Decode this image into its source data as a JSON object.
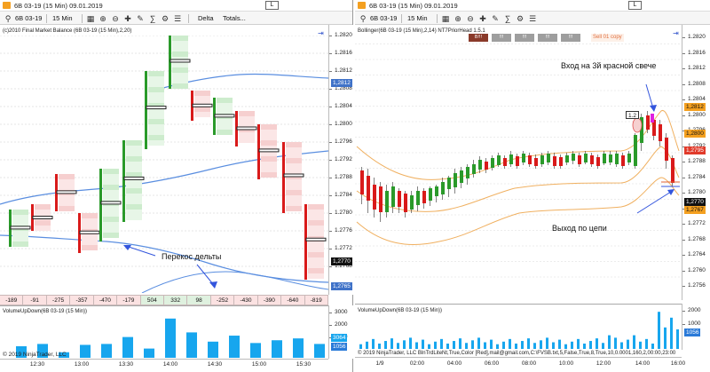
{
  "left_window": {
    "title": "6B 03-19 (15 Min)  09.01.2019",
    "maximize_label": "L",
    "toolbar": {
      "instrument": "6B 03-19",
      "timeframe": "15 Min",
      "style": "Delta",
      "totals": "Totals..."
    },
    "chart_label": "(c)2010 Final Market Balance  (6B 03-19 (15 Min),2,20)",
    "price_labels": [
      "1.2820",
      "1.2816",
      "1.2812",
      "1.2808",
      "1.2804",
      "1.2800",
      "1.2796",
      "1.2792",
      "1.2788",
      "1.2784",
      "1.2780",
      "1.2776",
      "1.2772",
      "1.2768"
    ],
    "tags": {
      "upper_band": "1,2812",
      "last_price": "1,2770",
      "lower_band": "1,2765"
    },
    "delta_row": [
      "-189",
      "-91",
      "-275",
      "-357",
      "-470",
      "-179",
      "504",
      "332",
      "98",
      "-252",
      "-430",
      "-390",
      "-640",
      "-819"
    ],
    "annotation": "Перекос дельты",
    "volume_label": "VolumeUpDown(6B 03-19 (15 Min))",
    "volume_axis": [
      "3000",
      "2000",
      "1000"
    ],
    "volume_tags": [
      "3064",
      "1056"
    ],
    "copyright": "© 2019 NinjaTrader, LLC",
    "time_labels": [
      "12:30",
      "13:00",
      "13:30",
      "14:00",
      "14:30",
      "15:00",
      "15:30"
    ]
  },
  "right_window": {
    "title": "6B 03-19 (15 Min)  09.01.2019",
    "maximize_label": "L",
    "toolbar": {
      "instrument": "6B 03-19",
      "timeframe": "15 Min"
    },
    "chart_label": "Bollinger(6B 03-19 (15 Min),2,14)  NT7PriorHead 1.5.1",
    "signal_buttons": [
      "B!!!",
      "!!!",
      "!!!",
      "!!!",
      "!!!"
    ],
    "sell_copy": "Sell 01 copy",
    "price_labels": [
      "1.2820",
      "1.2816",
      "1.2812",
      "1.2808",
      "1.2804",
      "1.2800",
      "1.2796",
      "1.2792",
      "1.2788",
      "1.2784",
      "1.2780",
      "1.2776",
      "1.2772",
      "1.2768",
      "1.2764",
      "1.2760",
      "1.2756"
    ],
    "tags": {
      "t1": "1,2812",
      "t2": "1,2800",
      "t3": "1,2795",
      "last_price": "1,2770",
      "t5": "1,2767"
    },
    "annotation_entry": "Вход на 3й красной свече",
    "annotation_exit": "Выход по цепи",
    "bubble": "1.2",
    "volume_label": "VolumeUpDown(6B 03-19 (15 Min))",
    "volume_axis": [
      "2000",
      "1000"
    ],
    "volume_tags": [
      "1056"
    ],
    "copyright": "© 2019 NinjaTrader, LLC  BlnTrdLiteNt,True,Color [Red],mail@gmail.com,C:\\FVSB.txt,5,False,True,8,True,10,0.0001,160,2,00:00,23:00",
    "time_labels": [
      "1/9",
      "02:00",
      "04:00",
      "06:00",
      "08:00",
      "10:00",
      "12:00",
      "14:00",
      "16:00"
    ]
  },
  "colors": {
    "up": "#2a9a2a",
    "down": "#d91a1a",
    "band": "#f0b060",
    "ma": "#5a8ee0",
    "volume": "#17a6ee",
    "arrow": "#3355dd"
  }
}
